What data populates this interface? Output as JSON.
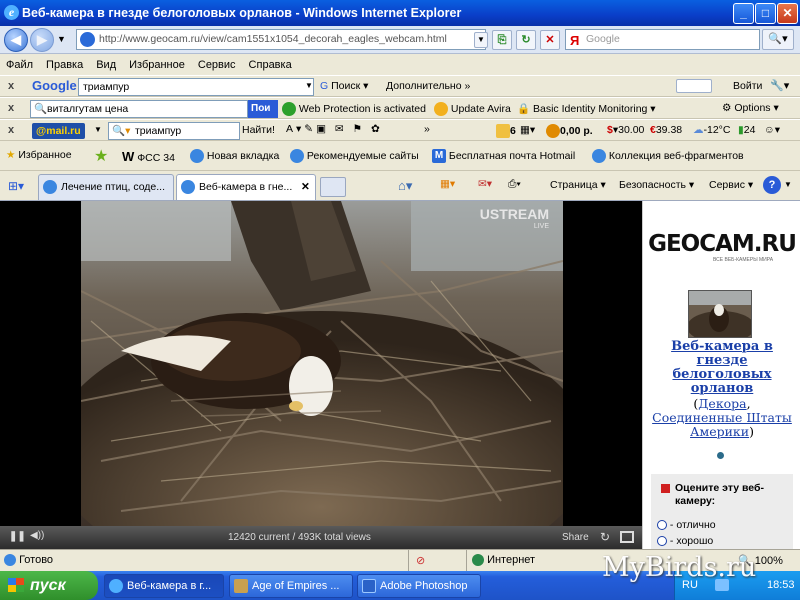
{
  "window": {
    "title": "Веб-камера в гнезде белоголовых орланов - Windows Internet Explorer"
  },
  "address": {
    "url": "http://www.geocam.ru/view/cam1551x1054_decorah_eagles_webcam.html",
    "search_placeholder": "Google"
  },
  "menu": [
    "Файл",
    "Правка",
    "Вид",
    "Избранное",
    "Сервис",
    "Справка"
  ],
  "google_bar": {
    "close": "x",
    "brand": "Google",
    "query": "триампур",
    "search_label": "Поиск",
    "more_label": "Дополнительно",
    "signin_label": "Войти"
  },
  "avira_bar": {
    "close": "x",
    "query": "виталгутам цена",
    "search_btn": "Пои",
    "protection": "Web Protection is activated",
    "update": "Update Avira",
    "identity": "Basic Identity Monitoring",
    "options": "Options"
  },
  "mail_bar": {
    "close": "x",
    "brand": "@mail.ru",
    "query": "триампур",
    "find_label": "Найти!",
    "mail_count": "6",
    "money": "0,00 р.",
    "usd": "30.00",
    "eur": "39.38",
    "weather": "-12°C",
    "count2": "24"
  },
  "favorites": {
    "label": "Избранное",
    "items": [
      "ФСС 34",
      "Новая вкладка",
      "Рекомендуемые сайты",
      "Бесплатная почта Hotmail",
      "Коллекция веб-фрагментов"
    ]
  },
  "tabs": [
    {
      "label": "Лечение птиц, соде...",
      "active": false
    },
    {
      "label": "Веб-камера в гне...",
      "active": true
    }
  ],
  "command_bar": {
    "page": "Страница",
    "safety": "Безопасность",
    "tools": "Сервис"
  },
  "player": {
    "watermark": "USTREAM",
    "watermark_sub": "LIVE",
    "counts": "12420 current / 493K total views",
    "share": "Share"
  },
  "sidebar": {
    "logo": "GEOCAM.RU",
    "logo_sub": "ВСЕ ВЕБ-КАМЕРЫ МИРА",
    "cam_title": "Веб-камера в гнезде белоголовых орланов",
    "loc_open": "(",
    "loc_city": "Декора",
    "loc_sep": ",",
    "loc_country": "Соединенные Штаты Америки",
    "loc_close": ")",
    "rate_label": "Оцените эту веб-камеру:",
    "rate_options": [
      "- отлично",
      "- хорошо"
    ]
  },
  "status": {
    "text": "Готово",
    "zone": "Интернет",
    "zoom": "100%"
  },
  "taskbar": {
    "start": "пуск",
    "tasks": [
      "Веб-камера в г...",
      "Age of Empires ...",
      "Adobe Photoshop"
    ],
    "lang": "RU",
    "clock": "18:53"
  },
  "overlay_watermark": "MyBirds.ru",
  "colors": {
    "title_blue": "#0a3ec8",
    "link_blue": "#1a3fa8",
    "taskbar_blue": "#245edb",
    "start_green": "#3a9a36"
  }
}
